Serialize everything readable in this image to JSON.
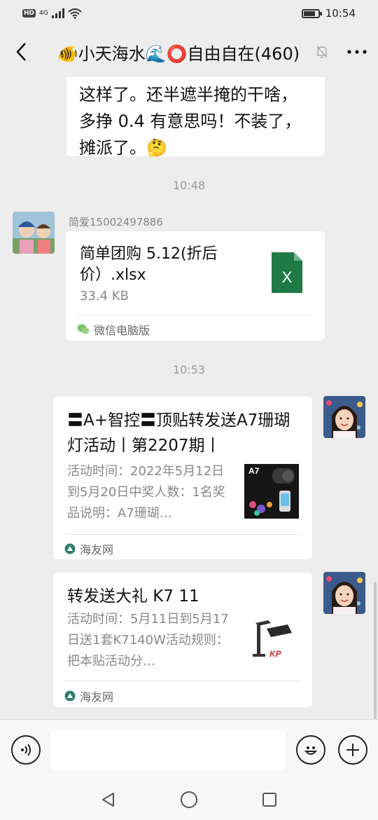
{
  "status_bar": {
    "network": "4G",
    "hd": "HD",
    "time": "10:54"
  },
  "header": {
    "title": "🐠小天海水🌊⭕自由自在(460)"
  },
  "messages": {
    "text_bubble": {
      "lines": [
        "这样了。还半遮半掩的干啥，",
        "多挣 0.4 有意思吗！不装了，",
        "摊派了。🤔"
      ]
    },
    "time1": "10:48",
    "file": {
      "sender": "简爱15002497886",
      "name": "简单团购 5.12(折后价）.xlsx",
      "size": "33.4 KB",
      "icon_letter": "X",
      "source": "微信电脑版"
    },
    "time2": "10:53",
    "link1": {
      "title": "〓A+智控〓顶贴转发送A7珊瑚灯活动丨第2207期丨",
      "desc": "活动时间：2022年5月12日到5月20日中奖人数：1名奖品说明：A7珊瑚…",
      "thumb_label": "A7",
      "source": "海友网"
    },
    "link2": {
      "title": "转发送大礼 K7 11",
      "desc": "活动时间：5月11日到5月17日送1套K7140W活动规则：把本贴活动分…",
      "thumb_label": "KP",
      "source": "海友网"
    }
  },
  "icons": {
    "back": "chevron-left-icon",
    "mute": "bell-off-icon",
    "more": "more-icon",
    "voice": "voice-icon",
    "emoji": "emoji-icon",
    "plus": "plus-icon"
  },
  "colors": {
    "background": "#ededed",
    "bubble": "#ffffff",
    "excel_green": "#1f7a45",
    "time_text": "#999999"
  }
}
